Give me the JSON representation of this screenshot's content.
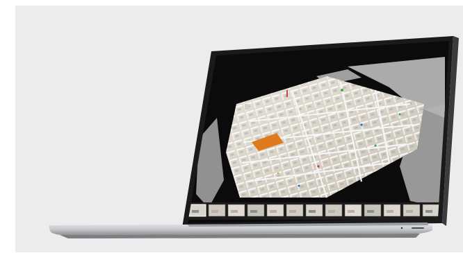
{
  "app": {
    "title": "",
    "subtitle": ""
  },
  "viewer": {
    "view_mode": "dollhouse",
    "scene": "3d-office-floor-scan"
  },
  "thumbnail_strip": {
    "count": 13,
    "selected_index": 0,
    "labels": []
  },
  "colors": {
    "background": "#ececec",
    "screen_bezel": "#111111",
    "viewport_bg": "#0b0b0b",
    "laptop_body": "#c9cbce",
    "highlight_room": "#e07a1f",
    "floor": "#d8d3c8"
  }
}
